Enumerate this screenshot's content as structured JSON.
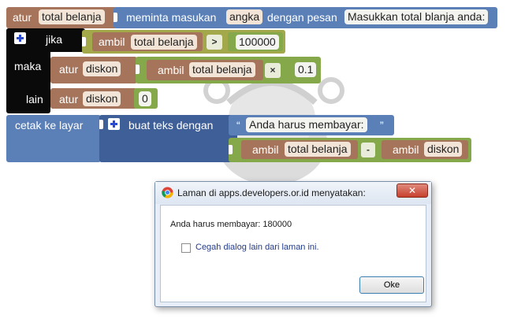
{
  "workspace": {
    "set_block": {
      "keyword": "atur",
      "variable": "total belanja"
    },
    "prompt_block": {
      "prefix": "meminta masukan",
      "type": "angka",
      "middle": "dengan pesan",
      "message": "Masukkan total blanja anda:"
    },
    "if_block": {
      "if_label": "jika",
      "then_label": "maka",
      "else_label": "lain"
    },
    "condition": {
      "get_label": "ambil",
      "variable": "total belanja",
      "operator": ">",
      "value": "100000"
    },
    "then_set": {
      "keyword": "atur",
      "variable": "diskon",
      "get_label": "ambil",
      "get_variable": "total belanja",
      "operator": "×",
      "value": "0.1"
    },
    "else_set": {
      "keyword": "atur",
      "variable": "diskon",
      "value": "0"
    },
    "print_block": {
      "label": "cetak ke layar",
      "join_label": "buat teks dengan",
      "open_quote": "“",
      "text": "Anda harus membayar:",
      "close_quote": "”",
      "get_label_1": "ambil",
      "variable_1": "total belanja",
      "operator": "-",
      "get_label_2": "ambil",
      "variable_2": "diskon"
    }
  },
  "dialog": {
    "title": "Laman di apps.developers.or.id menyatakan:",
    "message": "Anda harus membayar: 180000",
    "checkbox_label": "Cegah dialog lain dari laman ini.",
    "ok_label": "Oke",
    "close_glyph": "✕"
  },
  "colors": {
    "blue_block": "#5b80b8",
    "dark_blue_block": "#3e5f97",
    "orange_block": "#a5745b",
    "green_block": "#84a84a",
    "olive_block": "#a3a84a",
    "black_block": "#0a0a0a",
    "dialog_close": "#c7402e"
  }
}
